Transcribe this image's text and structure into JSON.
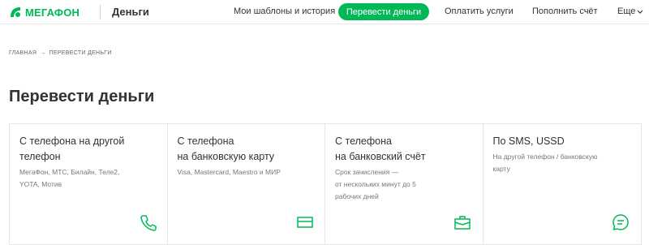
{
  "header": {
    "logo_text": "МЕГАФОН",
    "section": "Деньги",
    "nav": [
      {
        "label": "Мои шаблоны и история"
      },
      {
        "label": "Перевести деньги"
      },
      {
        "label": "Оплатить услуги"
      },
      {
        "label": "Пополнить счёт"
      }
    ],
    "more_label": "Еще"
  },
  "breadcrumb": {
    "home": "ГЛАВНАЯ",
    "separator": "→",
    "current": "ПЕРЕВЕСТИ ДЕНЬГИ"
  },
  "page": {
    "title": "Перевести деньги"
  },
  "cards": [
    {
      "title_line1": "С телефона на другой",
      "title_line2": "телефон",
      "sub_line1": "МегаФон, МТС, Билайн, Теле2,",
      "sub_line2": "YOTA, Мотив",
      "sub_line3": "",
      "icon": "phone-icon"
    },
    {
      "title_line1": "С телефона",
      "title_line2": "на банковскую карту",
      "sub_line1": "Visa, Mastercard, Maestro и МИР",
      "sub_line2": "",
      "sub_line3": "",
      "icon": "bank-card-icon"
    },
    {
      "title_line1": "С телефона",
      "title_line2": "на банковский счёт",
      "sub_line1": "Срок зачисления —",
      "sub_line2": "от нескольких минут до 5",
      "sub_line3": "рабочих дней",
      "icon": "briefcase-icon"
    },
    {
      "title_line1": "По SMS, USSD",
      "title_line2": "",
      "sub_line1": "На другой телефон / банковскую",
      "sub_line2": "карту",
      "sub_line3": "",
      "icon": "chat-bubble-icon"
    }
  ],
  "colors": {
    "brand": "#00b956",
    "text": "#333333",
    "muted": "#777777",
    "border": "#e6e6e6"
  }
}
